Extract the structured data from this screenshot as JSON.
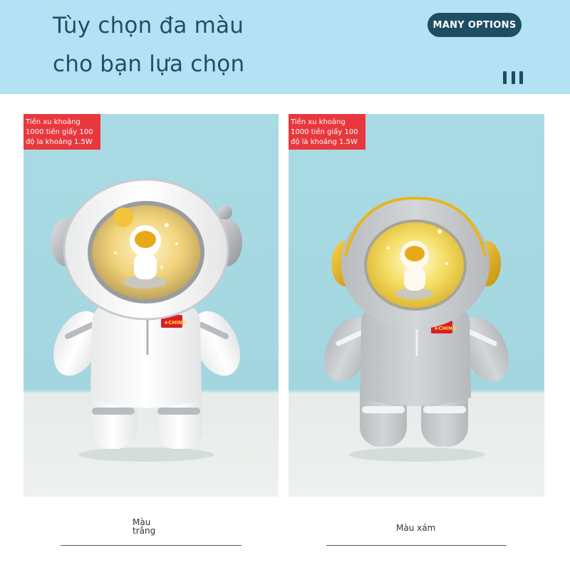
{
  "header": {
    "line1": "Tùy chọn đa màu",
    "line2": "cho bạn lựa chọn",
    "badge": "MANY OPTIONS",
    "menu_icon": "three-bars-icon"
  },
  "products": [
    {
      "spec": "Tiền xu khoảng 1000 tiền giấy 100 độ la khoảng 1.5W",
      "caption": "Màu trắng",
      "body_color": "#f7f7f7",
      "patch_text": "CHINA"
    },
    {
      "spec": "Tiền xu khoảng 1000 tiền giấy 100 độ là khoảng 1.5W",
      "caption": "Màu xám",
      "body_color": "#c9cccf",
      "patch_text": "CHINA"
    }
  ],
  "colors": {
    "banner": "#b4e1f3",
    "headline": "#1f5068",
    "badge": "#1e4e63",
    "spec_label": "#e8383d",
    "gold": "#e9b318",
    "silver": "#b8bcc0"
  }
}
